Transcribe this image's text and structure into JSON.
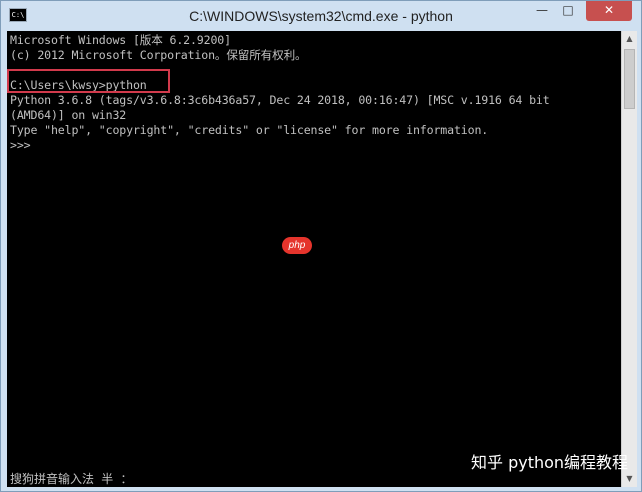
{
  "window": {
    "title": "C:\\WINDOWS\\system32\\cmd.exe - python",
    "icon_text": "C:\\",
    "buttons": {
      "minimize": "—",
      "maximize": "□",
      "close": "✕"
    }
  },
  "console": {
    "lines": [
      "Microsoft Windows [版本 6.2.9200]",
      "(c) 2012 Microsoft Corporation。保留所有权利。",
      "",
      "C:\\Users\\kwsy>python",
      "Python 3.6.8 (tags/v3.6.8:3c6b436a57, Dec 24 2018, 00:16:47) [MSC v.1916 64 bit",
      "(AMD64)] on win32",
      "Type \"help\", \"copyright\", \"credits\" or \"license\" for more information.",
      ">>>"
    ],
    "ime_status": "搜狗拼音输入法 半 ："
  },
  "overlays": {
    "php_badge": "php",
    "watermark": "知乎  python编程教程"
  },
  "colors": {
    "console_bg": "#000000",
    "console_text": "#c0c0c0",
    "highlight": "#d23a4c",
    "close_button": "#c7504f"
  }
}
